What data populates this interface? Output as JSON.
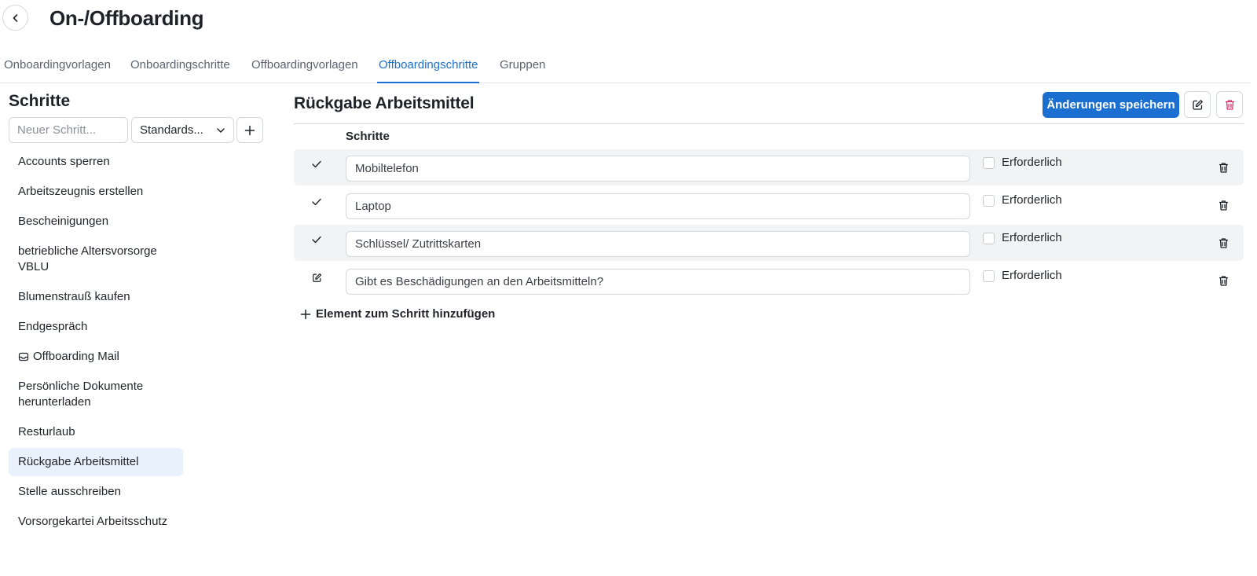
{
  "header": {
    "title": "On-/Offboarding"
  },
  "tabs": [
    {
      "label": "Onboardingvorlagen"
    },
    {
      "label": "Onboardingschritte"
    },
    {
      "label": "Offboardingvorlagen"
    },
    {
      "label": "Offboardingschritte",
      "active": true
    },
    {
      "label": "Gruppen"
    }
  ],
  "sidebar": {
    "title": "Schritte",
    "new_step_placeholder": "Neuer Schritt...",
    "type_select": "Standards...",
    "items": [
      {
        "label": "Accounts sperren"
      },
      {
        "label": "Arbeitszeugnis erstellen"
      },
      {
        "label": "Bescheinigungen"
      },
      {
        "label": "betriebliche Altersvorsorge VBLU"
      },
      {
        "label": "Blumenstrauß kaufen"
      },
      {
        "label": "Endgespräch"
      },
      {
        "label": "Offboarding Mail",
        "icon": "mail-icon"
      },
      {
        "label": "Persönliche Dokumente herunterladen"
      },
      {
        "label": "Resturlaub"
      },
      {
        "label": "Rückgabe Arbeitsmittel",
        "active": true
      },
      {
        "label": "Stelle ausschreiben"
      },
      {
        "label": "Vorsorgekartei Arbeitsschutz"
      }
    ]
  },
  "detail": {
    "title": "Rückgabe Arbeitsmittel",
    "save_label": "Änderungen speichern",
    "column_header": "Schritte",
    "required_label": "Erforderlich",
    "rows": [
      {
        "value": "Mobiltelefon",
        "icon": "check-icon",
        "required": false
      },
      {
        "value": "Laptop",
        "icon": "check-icon",
        "required": false
      },
      {
        "value": "Schlüssel/ Zutrittskarten",
        "icon": "check-icon",
        "required": false
      },
      {
        "value": "Gibt es Beschädigungen an den Arbeitsmitteln?",
        "icon": "edit-icon",
        "required": false
      }
    ],
    "add_element_label": "Element zum Schritt hinzufügen"
  },
  "colors": {
    "accent": "#1a6fd1",
    "active_bg": "#e8f1fc",
    "danger": "#d6336c"
  }
}
